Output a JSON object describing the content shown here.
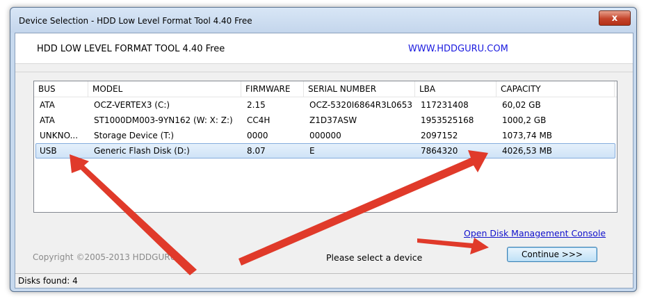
{
  "window": {
    "title": "Device Selection - HDD Low Level Format Tool 4.40    Free",
    "close_glyph": "x"
  },
  "header": {
    "app_name": "HDD LOW LEVEL FORMAT TOOL 4.40    Free",
    "url": "WWW.HDDGURU.COM"
  },
  "device_list": {
    "columns": [
      "BUS",
      "MODEL",
      "FIRMWARE",
      "SERIAL NUMBER",
      "LBA",
      "CAPACITY"
    ],
    "rows": [
      {
        "bus": "ATA",
        "model": "OCZ-VERTEX3 (C:)",
        "firmware": "2.15",
        "serial": "OCZ-5320I6864R3L0653",
        "lba": "117231408",
        "capacity": "60,02 GB"
      },
      {
        "bus": "ATA",
        "model": "ST1000DM003-9YN162 (W: X: Z:)",
        "firmware": "CC4H",
        "serial": "Z1D37ASW",
        "lba": "1953525168",
        "capacity": "1000,2 GB"
      },
      {
        "bus": "UNKNO...",
        "model": "Storage Device (T:)",
        "firmware": "0000",
        "serial": "000000",
        "lba": "2097152",
        "capacity": "1073,74 MB"
      },
      {
        "bus": "USB",
        "model": "Generic Flash Disk (D:)",
        "firmware": "8.07",
        "serial": "E",
        "lba": "7864320",
        "capacity": "4026,53 MB"
      }
    ],
    "selected_row": "USB"
  },
  "footer": {
    "disk_mgmt_link": "Open Disk Management Console",
    "copyright": "Copyright ©2005-2013 HDDGURU",
    "prompt": "Please select a device",
    "continue_label": "Continue >>>"
  },
  "status": {
    "disks_found": "Disks found: 4"
  },
  "colors": {
    "annotation_arrow": "#e03a2a",
    "link": "#1010cc",
    "selection": "#cfe3f7"
  }
}
